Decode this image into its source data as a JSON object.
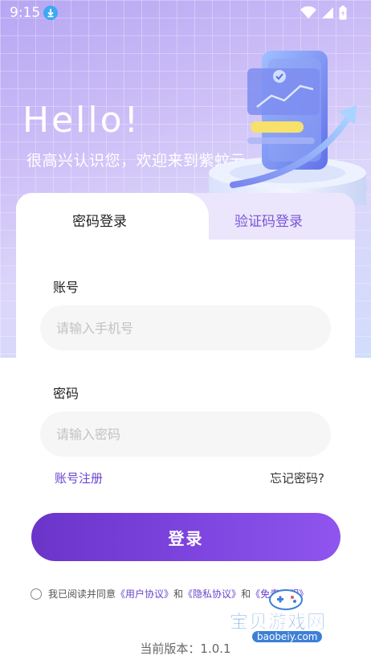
{
  "status_bar": {
    "time": "9:15"
  },
  "hero": {
    "title": "Hello!",
    "subtitle": "很高兴认识您，欢迎来到紫蚊云"
  },
  "tabs": [
    {
      "label": "密码登录",
      "active": true
    },
    {
      "label": "验证码登录",
      "active": false
    }
  ],
  "form": {
    "account_label": "账号",
    "account_placeholder": "请输入手机号",
    "password_label": "密码",
    "password_placeholder": "请输入密码",
    "register_link": "账号注册",
    "forgot_link": "忘记密码?",
    "login_button": "登录"
  },
  "agreement": {
    "prefix": "我已阅读并同意",
    "user_agreement": "《用户协议》",
    "and1": "和",
    "privacy_agreement": "《隐私协议》",
    "and2": "和",
    "disclaimer": "《免责声明》"
  },
  "version_text": "当前版本：1.0.1",
  "watermark": {
    "text": "宝贝游戏网",
    "url": "baobeiy.com"
  },
  "colors": {
    "accent": "#7a45dc",
    "link": "#6a43cf",
    "hero_start": "#b6a6f3",
    "hero_end": "#d2dcfb"
  }
}
